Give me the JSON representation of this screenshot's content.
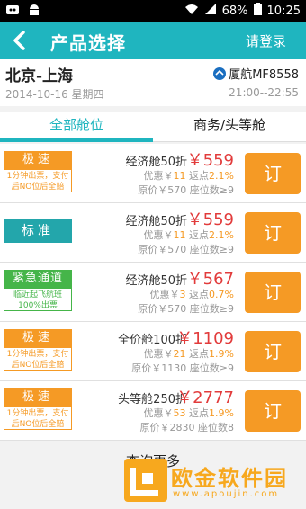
{
  "status_bar": {
    "battery": "68%",
    "time": "10:25",
    "icons": [
      "wifi-icon",
      "signal-icon",
      "battery-icon"
    ]
  },
  "app_bar": {
    "title": "产品选择",
    "login_label": "请登录"
  },
  "flight": {
    "route": "北京-上海",
    "airline": "厦航MF8558",
    "date": "2014-10-16 星期四",
    "time": "21:00--22:55"
  },
  "tabs": {
    "all": "全部舱位",
    "business": "商务/头等舱"
  },
  "fares": [
    {
      "tag_type": "orange",
      "tag_title": "极速",
      "tag_sub": "1分钟出票，支付后NO位后全赔",
      "cabin": "经济舱50折",
      "price": "￥559",
      "discount_prefix": "优惠￥",
      "discount_amount": "11",
      "rebate_label": "返点",
      "rebate_rate": "2.1%",
      "original": "原价￥570 座位数≥9",
      "book_label": "订"
    },
    {
      "tag_type": "teal",
      "tag_title": "标准",
      "tag_sub": "",
      "cabin": "经济舱50折",
      "price": "￥559",
      "discount_prefix": "优惠￥",
      "discount_amount": "11",
      "rebate_label": "返点",
      "rebate_rate": "2.1%",
      "original": "原价￥570 座位数≥9",
      "book_label": "订"
    },
    {
      "tag_type": "green",
      "tag_title": "紧急通道",
      "tag_sub": "临近起飞航班100%出票",
      "cabin": "经济舱50折",
      "price": "￥567",
      "discount_prefix": "优惠￥",
      "discount_amount": "3",
      "rebate_label": "返点",
      "rebate_rate": "0.7%",
      "original": "原价￥570 座位数≥9",
      "book_label": "订"
    },
    {
      "tag_type": "orange",
      "tag_title": "极速",
      "tag_sub": "1分钟出票，支付后NO位后全赔",
      "cabin": "全价舱100折",
      "price": "￥1109",
      "discount_prefix": "优惠￥",
      "discount_amount": "21",
      "rebate_label": "返点",
      "rebate_rate": "1.9%",
      "original": "原价￥1130 座位数≥9",
      "book_label": "订"
    },
    {
      "tag_type": "orange",
      "tag_title": "极速",
      "tag_sub": "1分钟出票，支付后NO位后全赔",
      "cabin": "头等舱250折",
      "price": "￥2777",
      "discount_prefix": "优惠￥",
      "discount_amount": "53",
      "rebate_label": "返点",
      "rebate_rate": "1.9%",
      "original": "原价￥2830 座位数8",
      "book_label": "订"
    }
  ],
  "more_label": "查询更多",
  "watermark": {
    "cn": "欧金软件园",
    "en": "www.apoujin.com"
  },
  "colors": {
    "accent": "#1fb5bf",
    "orange": "#f59a25",
    "price_red": "#e23b3b",
    "green": "#45b549",
    "teal_tag": "#23a6ab"
  }
}
